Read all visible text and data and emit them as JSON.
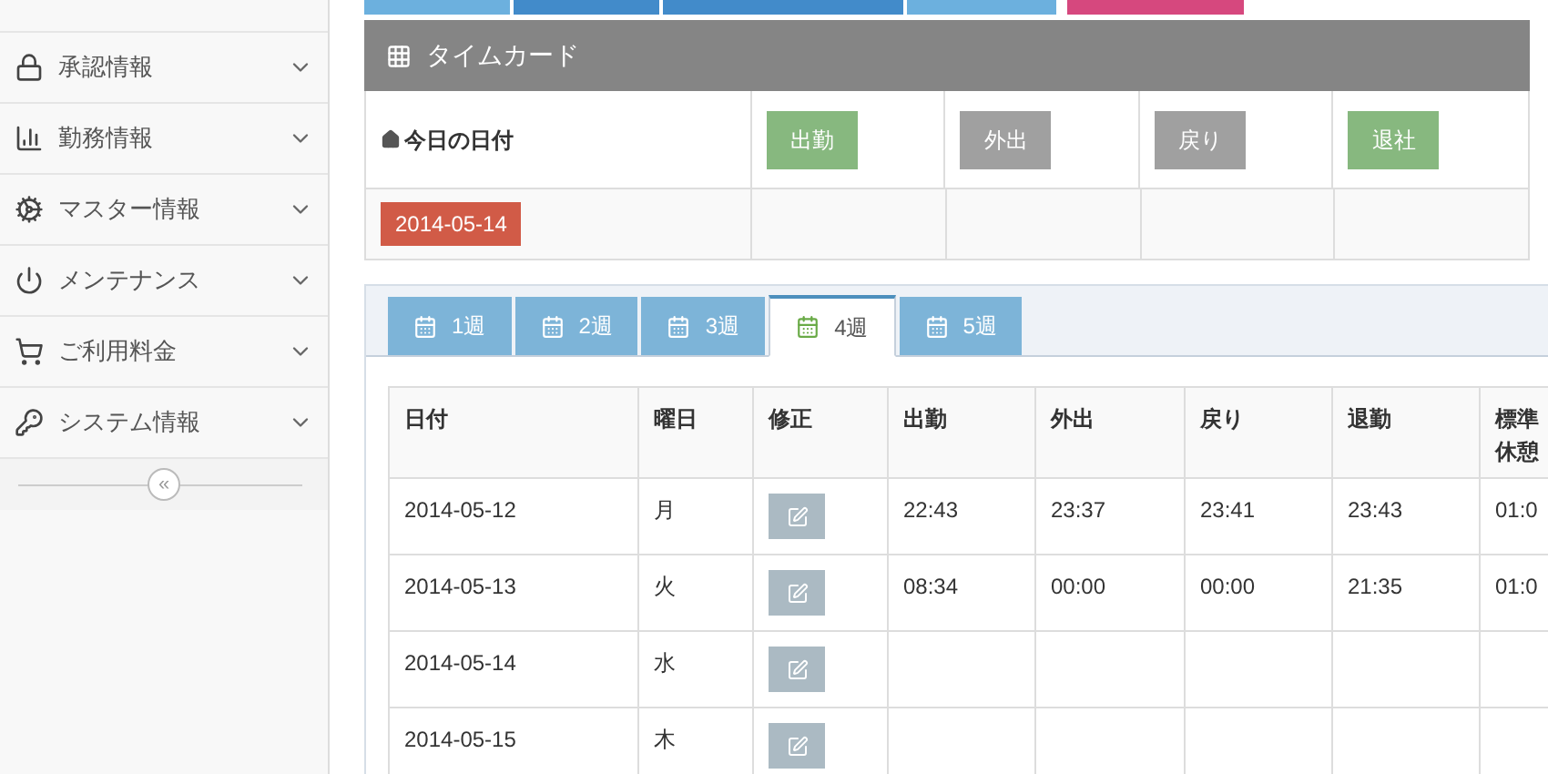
{
  "sidebar": {
    "items": [
      {
        "label": "承認情報",
        "expanded": false
      },
      {
        "label": "勤務情報",
        "expanded": false
      },
      {
        "label": "マスター情報",
        "expanded": false
      },
      {
        "label": "メンテナンス",
        "expanded": false
      },
      {
        "label": "ご利用料金",
        "expanded": false
      },
      {
        "label": "システム情報",
        "expanded": false
      }
    ],
    "collapse_button": "«"
  },
  "top_buttons": [
    {
      "color": "#6cb0de"
    },
    {
      "color": "#428bca"
    },
    {
      "color": "#428bca"
    },
    {
      "color": "#6cb0de"
    },
    {
      "color": "#d6487e"
    }
  ],
  "timecard": {
    "title": "タイムカード",
    "today_label": "今日の日付",
    "today": "2014-05-14",
    "buttons": [
      {
        "label": "出勤",
        "kind": "active"
      },
      {
        "label": "外出",
        "kind": "inactive"
      },
      {
        "label": "戻り",
        "kind": "inactive"
      },
      {
        "label": "退社",
        "kind": "active"
      }
    ]
  },
  "week_tabs": [
    {
      "label": "1週",
      "selected": false
    },
    {
      "label": "2週",
      "selected": false
    },
    {
      "label": "3週",
      "selected": false
    },
    {
      "label": "4週",
      "selected": true
    },
    {
      "label": "5週",
      "selected": false
    }
  ],
  "table": {
    "columns": [
      "日付",
      "曜日",
      "修正",
      "出勤",
      "外出",
      "戻り",
      "退勤",
      "標準休憩"
    ],
    "rows": [
      [
        "2014-05-12",
        "月",
        "",
        "22:43",
        "23:37",
        "23:41",
        "23:43",
        "01:0"
      ],
      [
        "2014-05-13",
        "火",
        "",
        "08:34",
        "00:00",
        "00:00",
        "21:35",
        "01:0"
      ],
      [
        "2014-05-14",
        "水",
        "",
        "",
        "",
        "",
        "",
        ""
      ],
      [
        "2014-05-15",
        "木",
        "",
        "",
        "",
        "",
        "",
        ""
      ]
    ]
  }
}
